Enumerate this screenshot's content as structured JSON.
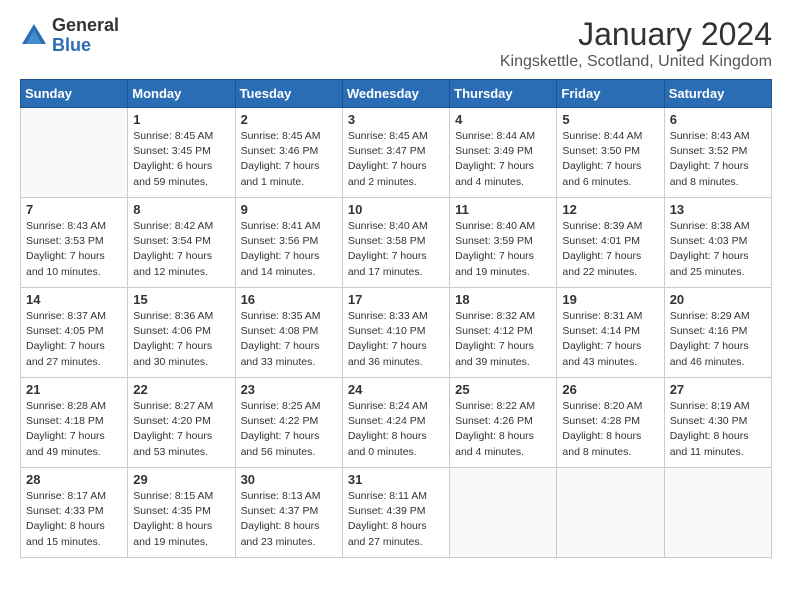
{
  "logo": {
    "general": "General",
    "blue": "Blue"
  },
  "header": {
    "title": "January 2024",
    "location": "Kingskettle, Scotland, United Kingdom"
  },
  "days_of_week": [
    "Sunday",
    "Monday",
    "Tuesday",
    "Wednesday",
    "Thursday",
    "Friday",
    "Saturday"
  ],
  "weeks": [
    [
      {
        "day": "",
        "info": ""
      },
      {
        "day": "1",
        "info": "Sunrise: 8:45 AM\nSunset: 3:45 PM\nDaylight: 6 hours\nand 59 minutes."
      },
      {
        "day": "2",
        "info": "Sunrise: 8:45 AM\nSunset: 3:46 PM\nDaylight: 7 hours\nand 1 minute."
      },
      {
        "day": "3",
        "info": "Sunrise: 8:45 AM\nSunset: 3:47 PM\nDaylight: 7 hours\nand 2 minutes."
      },
      {
        "day": "4",
        "info": "Sunrise: 8:44 AM\nSunset: 3:49 PM\nDaylight: 7 hours\nand 4 minutes."
      },
      {
        "day": "5",
        "info": "Sunrise: 8:44 AM\nSunset: 3:50 PM\nDaylight: 7 hours\nand 6 minutes."
      },
      {
        "day": "6",
        "info": "Sunrise: 8:43 AM\nSunset: 3:52 PM\nDaylight: 7 hours\nand 8 minutes."
      }
    ],
    [
      {
        "day": "7",
        "info": "Sunrise: 8:43 AM\nSunset: 3:53 PM\nDaylight: 7 hours\nand 10 minutes."
      },
      {
        "day": "8",
        "info": "Sunrise: 8:42 AM\nSunset: 3:54 PM\nDaylight: 7 hours\nand 12 minutes."
      },
      {
        "day": "9",
        "info": "Sunrise: 8:41 AM\nSunset: 3:56 PM\nDaylight: 7 hours\nand 14 minutes."
      },
      {
        "day": "10",
        "info": "Sunrise: 8:40 AM\nSunset: 3:58 PM\nDaylight: 7 hours\nand 17 minutes."
      },
      {
        "day": "11",
        "info": "Sunrise: 8:40 AM\nSunset: 3:59 PM\nDaylight: 7 hours\nand 19 minutes."
      },
      {
        "day": "12",
        "info": "Sunrise: 8:39 AM\nSunset: 4:01 PM\nDaylight: 7 hours\nand 22 minutes."
      },
      {
        "day": "13",
        "info": "Sunrise: 8:38 AM\nSunset: 4:03 PM\nDaylight: 7 hours\nand 25 minutes."
      }
    ],
    [
      {
        "day": "14",
        "info": "Sunrise: 8:37 AM\nSunset: 4:05 PM\nDaylight: 7 hours\nand 27 minutes."
      },
      {
        "day": "15",
        "info": "Sunrise: 8:36 AM\nSunset: 4:06 PM\nDaylight: 7 hours\nand 30 minutes."
      },
      {
        "day": "16",
        "info": "Sunrise: 8:35 AM\nSunset: 4:08 PM\nDaylight: 7 hours\nand 33 minutes."
      },
      {
        "day": "17",
        "info": "Sunrise: 8:33 AM\nSunset: 4:10 PM\nDaylight: 7 hours\nand 36 minutes."
      },
      {
        "day": "18",
        "info": "Sunrise: 8:32 AM\nSunset: 4:12 PM\nDaylight: 7 hours\nand 39 minutes."
      },
      {
        "day": "19",
        "info": "Sunrise: 8:31 AM\nSunset: 4:14 PM\nDaylight: 7 hours\nand 43 minutes."
      },
      {
        "day": "20",
        "info": "Sunrise: 8:29 AM\nSunset: 4:16 PM\nDaylight: 7 hours\nand 46 minutes."
      }
    ],
    [
      {
        "day": "21",
        "info": "Sunrise: 8:28 AM\nSunset: 4:18 PM\nDaylight: 7 hours\nand 49 minutes."
      },
      {
        "day": "22",
        "info": "Sunrise: 8:27 AM\nSunset: 4:20 PM\nDaylight: 7 hours\nand 53 minutes."
      },
      {
        "day": "23",
        "info": "Sunrise: 8:25 AM\nSunset: 4:22 PM\nDaylight: 7 hours\nand 56 minutes."
      },
      {
        "day": "24",
        "info": "Sunrise: 8:24 AM\nSunset: 4:24 PM\nDaylight: 8 hours\nand 0 minutes."
      },
      {
        "day": "25",
        "info": "Sunrise: 8:22 AM\nSunset: 4:26 PM\nDaylight: 8 hours\nand 4 minutes."
      },
      {
        "day": "26",
        "info": "Sunrise: 8:20 AM\nSunset: 4:28 PM\nDaylight: 8 hours\nand 8 minutes."
      },
      {
        "day": "27",
        "info": "Sunrise: 8:19 AM\nSunset: 4:30 PM\nDaylight: 8 hours\nand 11 minutes."
      }
    ],
    [
      {
        "day": "28",
        "info": "Sunrise: 8:17 AM\nSunset: 4:33 PM\nDaylight: 8 hours\nand 15 minutes."
      },
      {
        "day": "29",
        "info": "Sunrise: 8:15 AM\nSunset: 4:35 PM\nDaylight: 8 hours\nand 19 minutes."
      },
      {
        "day": "30",
        "info": "Sunrise: 8:13 AM\nSunset: 4:37 PM\nDaylight: 8 hours\nand 23 minutes."
      },
      {
        "day": "31",
        "info": "Sunrise: 8:11 AM\nSunset: 4:39 PM\nDaylight: 8 hours\nand 27 minutes."
      },
      {
        "day": "",
        "info": ""
      },
      {
        "day": "",
        "info": ""
      },
      {
        "day": "",
        "info": ""
      }
    ]
  ]
}
